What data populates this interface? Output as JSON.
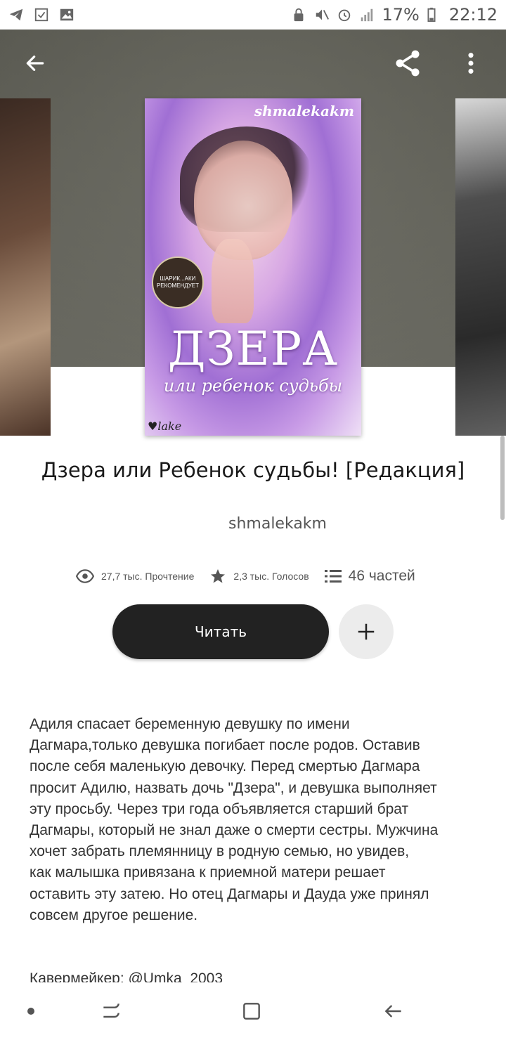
{
  "status_bar": {
    "battery": "17%",
    "time": "22:12",
    "left_icons": [
      "telegram-icon",
      "checklist-icon",
      "gallery-icon"
    ],
    "right_icons": [
      "lock-icon",
      "mute-icon",
      "alarm-icon",
      "signal-icon",
      "battery-icon"
    ]
  },
  "toolbar": {
    "back_icon": "arrow-left-icon",
    "share_icon": "share-icon",
    "menu_icon": "more-vertical-icon"
  },
  "cover": {
    "author_mark": "shmalekakm",
    "badge_line1": "ШАРИК...АКИ",
    "badge_line2": "РЕКОМЕНДУЕТ",
    "title": "ДЗЕРА",
    "subtitle": "или ребенок судьбы",
    "signature": "lake"
  },
  "book": {
    "title": "Дзера или Ребенок судьбы! [Редакция]",
    "author": "shmalekakm",
    "reads": "27,7 тыс. Прочтение",
    "votes": "2,3 тыс. Голосов",
    "parts": "46 частей",
    "read_label": "Читать",
    "description": "Адиля спасает беременную девушку по имени\nДагмара,только девушка погибает после родов. Оставив\nпосле себя маленькую девочку. Перед смертью Дагмара\nпросит Адилю, назвать дочь \"Дзера\", и девушка выполняет\nэту просьбу. Через три года объявляется старший брат\nДагмары, который не знал даже о смерти сестры. Мужчина\nхочет забрать племянницу в родную семью, но увидев,\nкак малышка привязана к приемной матери решает\nоставить эту затею. Но отец Дагмары и Дауда уже принял\nсовсем другое решение.",
    "credit": "Кавермейкер: @Umka_2003"
  },
  "colors": {
    "primary_button": "#222222",
    "secondary_button": "#ececec",
    "hero_bg": "#62625a"
  }
}
